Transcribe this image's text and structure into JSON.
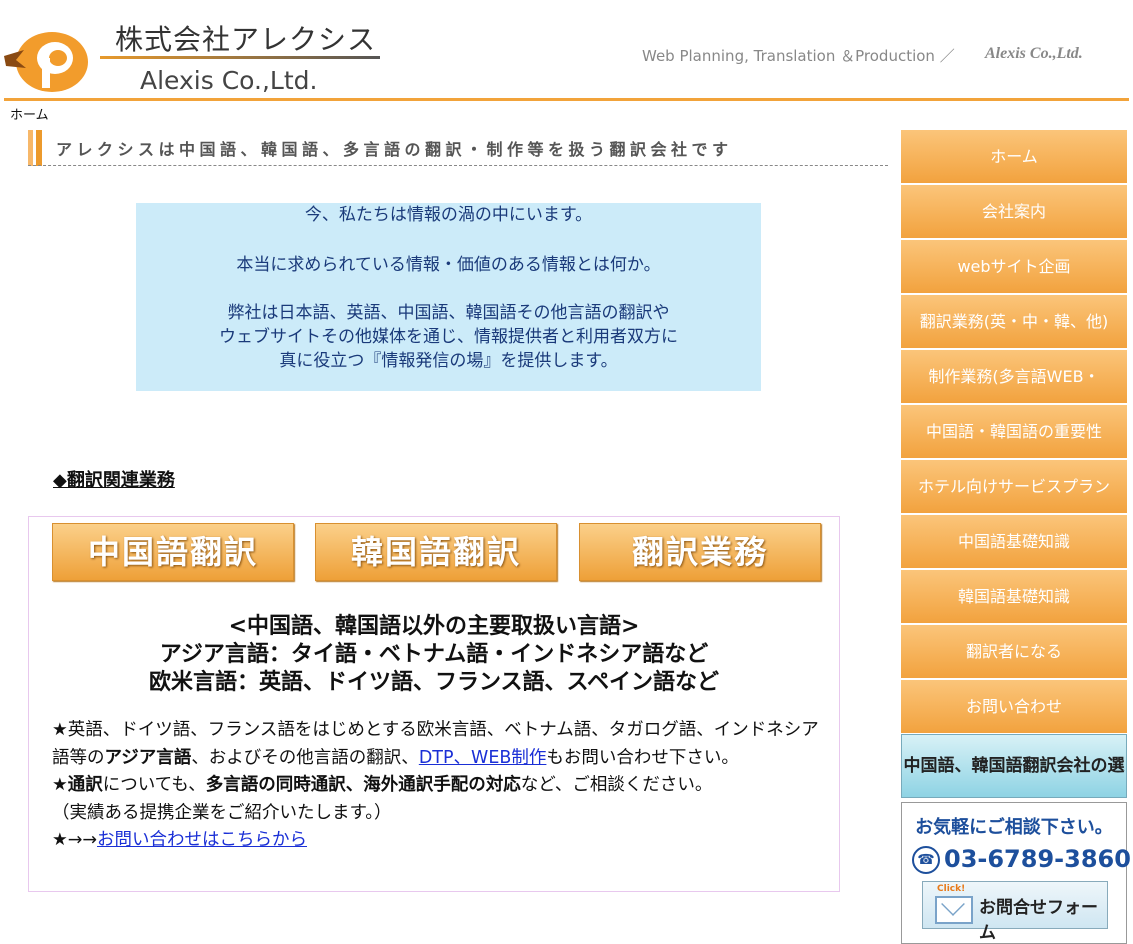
{
  "header": {
    "company_jp": "株式会社アレクシス",
    "company_en": "Alexis Co.,Ltd.",
    "tagline": "Web Planning, Translation ＆Production ／",
    "tagline_brand": "Alexis Co.,Ltd."
  },
  "breadcrumb": "ホーム",
  "heading": "アレクシスは中国語、韓国語、多言語の翻訳・制作等を扱う翻訳会社です",
  "intro": {
    "line1": "今、私たちは情報の渦の中にいます。",
    "line2": "本当に求められている情報・価値のある情報とは何か。",
    "line3a": "弊社は日本語、英語、中国語、韓国語その他言語の翻訳や",
    "line3b": "ウェブサイトその他媒体を通じ、情報提供者と利用者双方に",
    "line3c": "真に役立つ『情報発信の場』を提供します。"
  },
  "section_title": "◆翻訳関連業務",
  "services": {
    "buttons": [
      "中国語翻訳",
      "韓国語翻訳",
      "翻訳業務"
    ],
    "lang_title1": "<中国語、韓国語以外の主要取扱い言語>",
    "lang_title2": "アジア言語：タイ語・ベトナム語・インドネシア語など",
    "lang_title3": "欧米言語：英語、ドイツ語、フランス語、スペイン語など",
    "p1_a": "★英語、ドイツ語、フランス語をはじめとする欧米言語、ベトナム語、タガログ語、インドネシア語等の",
    "p1_b": "アジア言語",
    "p1_c": "、およびその他言語の翻訳、",
    "p1_link": "DTP、WEB制作",
    "p1_d": "もお問い合わせ下さい。",
    "p2_star": "★",
    "p2_a": "通訳",
    "p2_b": "についても、",
    "p2_c": "多言語の同時通訳、海外通訳手配の対応",
    "p2_d": "など、ご相談ください。",
    "p3": "（実績ある提携企業をご紹介いたします。）",
    "p4_a": "★→→",
    "p4_link": "お問い合わせはこちらから"
  },
  "sidebar": {
    "items": [
      "ホーム",
      "会社案内",
      "webサイト企画",
      "翻訳業務(英・中・韓、他)",
      "制作業務(多言語WEB・",
      "中国語・韓国語の重要性",
      "ホテル向けサービスプラン",
      "中国語基礎知識",
      "韓国語基礎知識",
      "翻訳者になる",
      "お問い合わせ"
    ],
    "choose_banner": "中国語、韓国語翻訳会社の選び方",
    "contact": {
      "headline": "お気軽にご相談下さい。",
      "phone": "03-6789-3860",
      "click": "Click!",
      "form_label": "お問合せフォーム"
    }
  },
  "colors": {
    "accent": "#f2a33a",
    "link": "#1a2fd6",
    "intro_bg": "#ccebf9"
  }
}
